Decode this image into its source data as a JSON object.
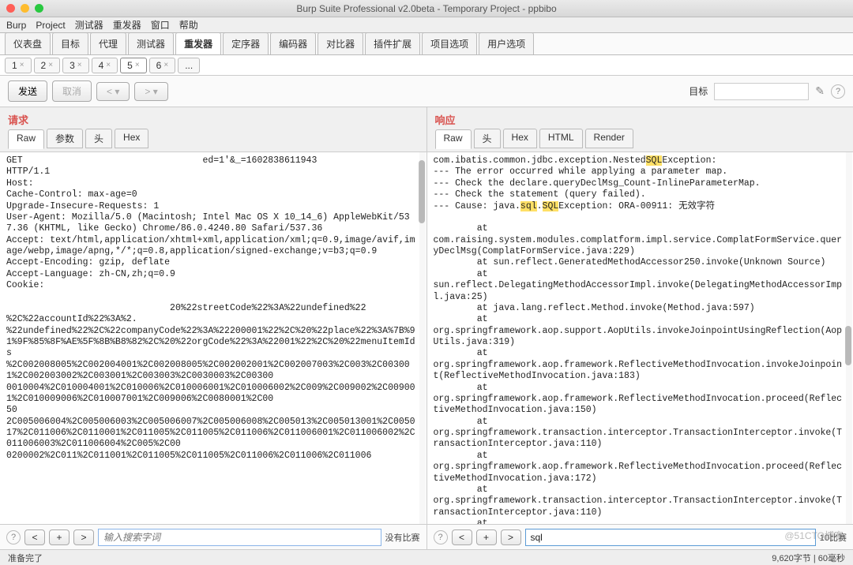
{
  "window": {
    "title": "Burp Suite Professional v2.0beta - Temporary Project - ppbibo"
  },
  "menu": {
    "burp": "Burp",
    "project": "Project",
    "tester": "测试器",
    "repeater": "重发器",
    "window": "窗口",
    "help": "帮助"
  },
  "tools": {
    "dashboard": "仪表盘",
    "target": "目标",
    "proxy": "代理",
    "intruder": "测试器",
    "repeater": "重发器",
    "sequencer": "定序器",
    "decoder": "编码器",
    "comparer": "对比器",
    "extender": "插件扩展",
    "projopts": "项目选项",
    "useropts": "用户选项"
  },
  "repeater_tabs": [
    "1",
    "2",
    "3",
    "4",
    "5",
    "6",
    "..."
  ],
  "repeater_active": 5,
  "toolbar": {
    "send": "发送",
    "cancel": "取消",
    "prev": "<",
    "next": ">",
    "target_label": "目标",
    "edit_icon": "✎",
    "help_icon": "?"
  },
  "request": {
    "title": "请求",
    "tabs": {
      "raw": "Raw",
      "params": "参数",
      "headers": "头",
      "hex": "Hex"
    },
    "body": "GET                                 ed=1'&_=1602838611943\nHTTP/1.1\nHost:\nCache-Control: max-age=0\nUpgrade-Insecure-Requests: 1\nUser-Agent: Mozilla/5.0 (Macintosh; Intel Mac OS X 10_14_6) AppleWebKit/537.36 (KHTML, like Gecko) Chrome/86.0.4240.80 Safari/537.36\nAccept: text/html,application/xhtml+xml,application/xml;q=0.9,image/avif,image/webp,image/apng,*/*;q=0.8,application/signed-exchange;v=b3;q=0.9\nAccept-Encoding: gzip, deflate\nAccept-Language: zh-CN,zh;q=0.9\nCookie:\n\n                              20%22streetCode%22%3A%22undefined%22\n%2C%22accountId%22%3A%2.\n%22undefined%22%2C%22companyCode%22%3A%22200001%22%2C%20%22place%22%3A%7B%91%9F%85%8F%AE%5F%8B%B8%82%2C%20%22orgCode%22%3A%22001%22%2C%20%22menuItemIds\n%2C002008005%2C002004001%2C002008005%2C002002001%2C002007003%2C003%2C003001%2C002003002%2C003001%2C003003%2C0030003%2C00300\n0010004%2C010004001%2C010006%2C010006001%2C010006002%2C009%2C009002%2C009001%2C010009006%2C010007001%2C009006%2C0080001%2C00\n50\n2C005006004%2C005006003%2C005006007%2C005006008%2C005013%2C005013001%2C005017%2C011006%2C0110001%2C011005%2C011005%2C011006%2C011006001%2C011006002%2C011006003%2C011006004%2C005%2C00\n0200002%2C011%2C011001%2C011005%2C011005%2C011006%2C011006%2C011006",
    "search_placeholder": "输入搜索字词",
    "no_match": "没有比赛"
  },
  "response": {
    "title": "响应",
    "tabs": {
      "raw": "Raw",
      "headers": "头",
      "hex": "Hex",
      "html": "HTML",
      "render": "Render"
    },
    "body_segments": [
      {
        "t": "com.ibatis.common.jdbc.exception.Nested"
      },
      {
        "t": "SQL",
        "hl": true
      },
      {
        "t": "Exception:\n--- The error occurred while applying a parameter map.\n--- Check the declare.queryDeclMsg_Count-InlineParameterMap.\n--- Check the statement (query failed).\n--- Cause: java."
      },
      {
        "t": "sql",
        "hl": true
      },
      {
        "t": "."
      },
      {
        "t": "SQL",
        "hl": true
      },
      {
        "t": "Exception: ORA-00911: 无效字符\n\n        at\ncom.raising.system.modules.complatform.impl.service.ComplatFormService.queryDeclMsg(ComplatFormService.java:229)\n        at sun.reflect.GeneratedMethodAccessor250.invoke(Unknown Source)\n        at\nsun.reflect.DelegatingMethodAccessorImpl.invoke(DelegatingMethodAccessorImpl.java:25)\n        at java.lang.reflect.Method.invoke(Method.java:597)\n        at\norg.springframework.aop.support.AopUtils.invokeJoinpointUsingReflection(AopUtils.java:319)\n        at\norg.springframework.aop.framework.ReflectiveMethodInvocation.invokeJoinpoint(ReflectiveMethodInvocation.java:183)\n        at\norg.springframework.aop.framework.ReflectiveMethodInvocation.proceed(ReflectiveMethodInvocation.java:150)\n        at\norg.springframework.transaction.interceptor.TransactionInterceptor.invoke(TransactionInterceptor.java:110)\n        at\norg.springframework.aop.framework.ReflectiveMethodInvocation.proceed(ReflectiveMethodInvocation.java:172)\n        at\norg.springframework.transaction.interceptor.TransactionInterceptor.invoke(TransactionInterceptor.java:110)\n        at"
      }
    ],
    "search_value": "sql",
    "match_count": "10比赛"
  },
  "status": {
    "left": "准备完了",
    "right": "9,620字节 | 60毫秒"
  },
  "watermark": "@51CTO博客"
}
